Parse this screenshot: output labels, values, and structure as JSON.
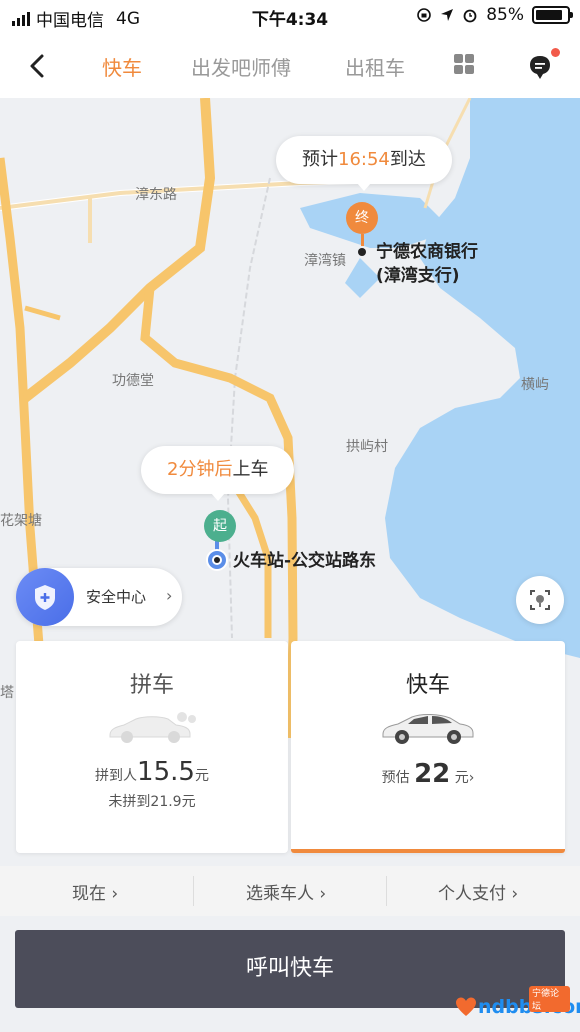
{
  "status_bar": {
    "carrier": "中国电信",
    "network": "4G",
    "time": "下午4:34",
    "battery": "85%",
    "battery_level": 0.85
  },
  "nav": {
    "tabs": [
      {
        "label": "快车",
        "active": true
      },
      {
        "label": "出发吧师傅",
        "active": false
      },
      {
        "label": "出租车",
        "active": false
      }
    ],
    "accent_color": "#f08a3d"
  },
  "map": {
    "labels": {
      "zhangdong_road": "漳东路",
      "zhangwan_town": "漳湾镇",
      "gongde_hall": "功德堂",
      "hengyu": "横屿",
      "gongyu_village": "拱屿村",
      "huajiatang": "花架塘",
      "ta": "塔"
    },
    "destination": {
      "eta_prefix": "预计",
      "eta_time": "16:54",
      "eta_suffix": "到达",
      "pin": "终",
      "name_line1": "宁德农商银行",
      "name_line2": "(漳湾支行)"
    },
    "origin": {
      "wait_time": "2分钟后",
      "wait_suffix": "上车",
      "pin": "起",
      "name": "火车站-公交站路东"
    },
    "safety_center": "安全中心"
  },
  "cards": {
    "carpool": {
      "title": "拼车",
      "matched_prefix": "拼到人",
      "matched_price": "15.5",
      "unit": "元",
      "unmatched": "未拼到21.9元"
    },
    "express": {
      "title": "快车",
      "estimate_prefix": "预估",
      "price": "22",
      "unit": "元",
      "chevron": "›"
    }
  },
  "options": {
    "now": "现在",
    "rider": "选乘车人",
    "payment": "个人支付",
    "chevron": "›"
  },
  "call_button": "呼叫快车",
  "watermark": {
    "text": "ndbbs.com",
    "badge": "宁德论坛"
  }
}
